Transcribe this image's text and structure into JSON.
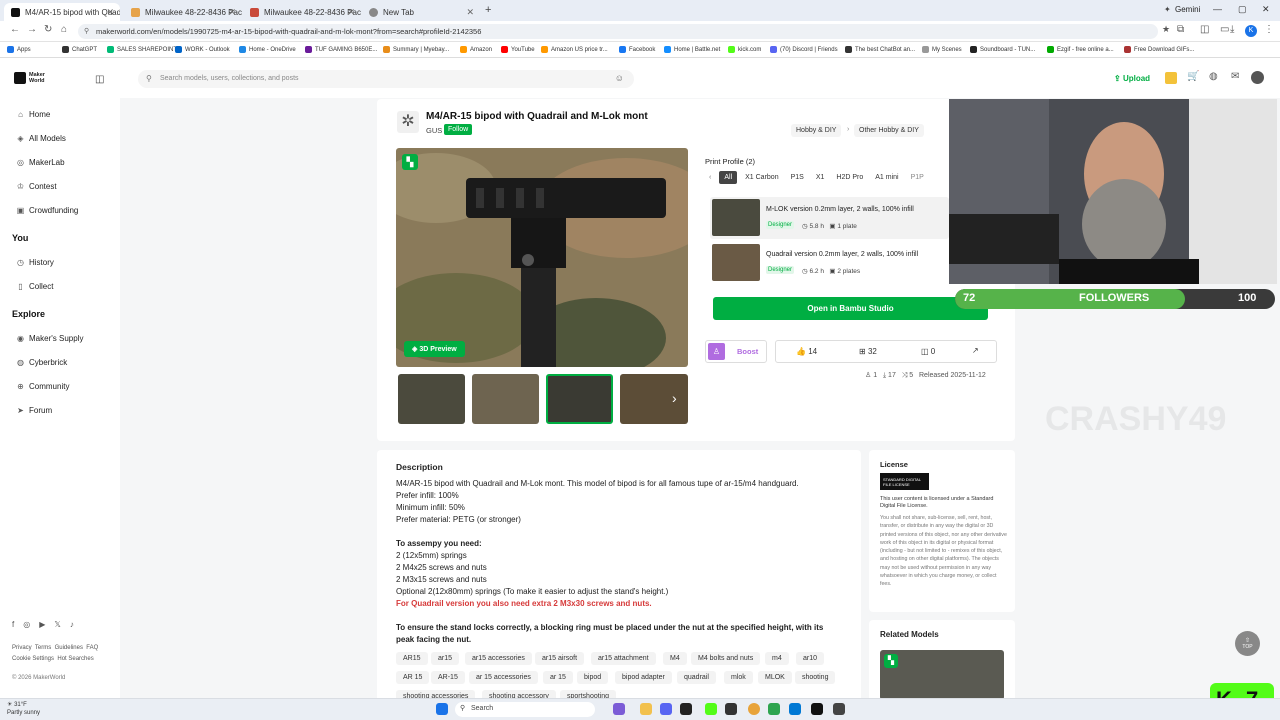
{
  "tabs": [
    {
      "title": "M4/AR-15 bipod with Quadrai",
      "color": "#111"
    },
    {
      "title": "Milwaukee 48-22-8436 Packou",
      "color": "#e6a34a"
    },
    {
      "title": "Milwaukee 48-22-8436 Packou",
      "color": "#c94a3a"
    },
    {
      "title": "New Tab",
      "color": "#888"
    }
  ],
  "browser": {
    "url": "makerworld.com/en/models/1990725-m4-ar-15-bipod-with-quadrail-and-m-lok-mont?from=search#profileId-2142356",
    "gemini": "Gemini",
    "new_tab": "+"
  },
  "bookmarks": [
    "Apps",
    "ChatGPT",
    "SALES SHAREPOINT",
    "WORK - Outlook",
    "Home - OneDrive",
    "TUF GAMING B650E...",
    "Summary | Myebay...",
    "Amazon",
    "YouTube",
    "Amazon US price tr...",
    "Facebook",
    "Home | Battle.net",
    "kick.com",
    "(70) Discord | Friends",
    "The best ChatBot an...",
    "My Scenes",
    "Soundboard - TUN...",
    "Ezgif - free online a...",
    "Free Download GIFs..."
  ],
  "logo": {
    "line1": "Maker",
    "line2": "World"
  },
  "sidebar": {
    "main": [
      "Home",
      "All Models",
      "MakerLab",
      "Contest",
      "Crowdfunding"
    ],
    "you_title": "You",
    "you": [
      "History",
      "Collect"
    ],
    "explore_title": "Explore",
    "explore": [
      "Maker's Supply",
      "Cyberbrick",
      "Community",
      "Forum"
    ],
    "footer_links": [
      "Privacy",
      "Terms",
      "Guidelines",
      "FAQ",
      "Cookie Settings",
      "Hot Searches"
    ],
    "copyright": "© 2026 MakerWorld"
  },
  "search": {
    "placeholder": "Search models, users, collections, and posts"
  },
  "upload": "Upload",
  "model": {
    "title": "M4/AR-15 bipod with Quadrail and M-Lok mont",
    "author": "GUS",
    "follow": "Follow",
    "breadcrumb": [
      "Hobby & DIY",
      "Other Hobby & DIY"
    ],
    "preview_btn": "3D Preview",
    "stats": {
      "likes": "14",
      "collects": "32",
      "comments": "0",
      "boost": "Boost"
    },
    "meta": {
      "a": "1",
      "b": "17",
      "c": "5",
      "released": "Released 2025-11-12"
    }
  },
  "print_profile": {
    "title": "Print Profile (2)",
    "filters": [
      "All",
      "X1 Carbon",
      "P1S",
      "X1",
      "H2D Pro",
      "A1 mini",
      "P1P"
    ],
    "items": [
      {
        "name": "M-LOK version 0.2mm layer, 2 walls, 100% infill",
        "badge": "Designer",
        "time": "5.8 h",
        "plates": "1",
        "plate_label": "plate"
      },
      {
        "name": "Quadrail version 0.2mm layer, 2 walls, 100% infill",
        "badge": "Designer",
        "time": "6.2 h",
        "plates": "2",
        "plate_label": "plates"
      }
    ],
    "open_btn": "Open in Bambu Studio"
  },
  "overlay": {
    "followers_label": "FOLLOWERS",
    "current": "72",
    "goal": "100",
    "progress": 0.72,
    "watermark": "CRASHY49"
  },
  "description": {
    "title": "Description",
    "lines": [
      "M4/AR-15 bipod with Quadrail and M-Lok mont. This model of bipod is for all famous tupe of ar-15/m4 handguard.",
      "Prefer infill: 100%",
      "Minimum infill: 50%",
      "Prefer material: PETG (or stronger)"
    ],
    "assembly_title": "To assempy you need:",
    "assembly": [
      "2 (12x5mm) springs",
      "2 M4x25 screws and nuts",
      "2 M3x15 screws and nuts",
      "Optional 2(12x80mm) springs (To make it easier to adjust the stand's height.)"
    ],
    "red_note": "For Quadrail version you also need extra 2 M3x30 screws and nuts.",
    "lock_note": "To ensure the stand locks correctly, a blocking ring must be placed under the nut at the specified height, with its peak facing the nut."
  },
  "tags": [
    "AR15",
    "ar15",
    "ar15 accessories",
    "ar15 airsoft",
    "ar15 attachment",
    "M4",
    "M4 bolts and nuts",
    "m4",
    "ar10",
    "AR 15",
    "AR-15",
    "ar 15 accessories",
    "ar 15",
    "bipod",
    "bipod adapter",
    "quadrail",
    "mlok",
    "MLOK",
    "shooting",
    "shooting accessories",
    "shooting accessory",
    "sportshooting"
  ],
  "license": {
    "title": "License",
    "badge_l1": "STANDARD DIGITAL",
    "badge_l2": "FILE LICENSE",
    "text1": "This user content is licensed under a Standard Digital File License.",
    "text2": "You shall not share, sub-license, sell, rent, host, transfer, or distribute in any way the digital or 3D printed versions of this object, nor any other derivative work of this object in its digital or physical format (including - but not limited to - remixes of this object, and hosting on other digital platforms). The objects may not be used without permission in any way whatsoever in which you charge money, or collect fees."
  },
  "related": {
    "title": "Related Models"
  },
  "top_btn": "TOP",
  "weather": {
    "temp": "31°F",
    "cond": "Partly sunny"
  },
  "taskbar": {
    "search": "Search"
  },
  "kick_badge": "7",
  "colors": {
    "green": "#00ae42",
    "kick": "#53fc18",
    "red": "#d63a3a",
    "boost": "#b06ce0"
  }
}
